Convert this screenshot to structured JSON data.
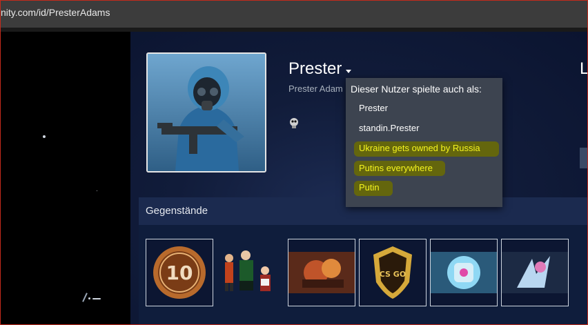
{
  "browser": {
    "url": "nity.com/id/PresterAdams"
  },
  "profile": {
    "persona_name": "Prester",
    "real_name": "Prester Adam",
    "level_label": "L"
  },
  "aliases_menu": {
    "heading": "Dieser Nutzer spielte auch als:",
    "items": [
      {
        "label": "Prester",
        "highlighted": false
      },
      {
        "label": "standin.Prester",
        "highlighted": false
      },
      {
        "label": "Ukraine gets owned by Russia",
        "highlighted": true
      },
      {
        "label": "Putins everywhere",
        "highlighted": true
      },
      {
        "label": "Putin",
        "highlighted": true
      }
    ],
    "highlight_color": "#66680a",
    "highlight_text_color": "#f5f51e"
  },
  "items_section": {
    "title": "Gegenstände",
    "items": [
      {
        "icon": "csgo-10-year-coin-icon",
        "text": "10"
      },
      {
        "icon": "cartoon-characters-icon"
      },
      {
        "icon": "dota-hero-artwork-icon"
      },
      {
        "icon": "csgo-gold-badge-icon",
        "text": "CS GO"
      },
      {
        "icon": "glowing-cube-icon"
      },
      {
        "icon": "dota-ice-hero-artwork-icon"
      }
    ]
  }
}
